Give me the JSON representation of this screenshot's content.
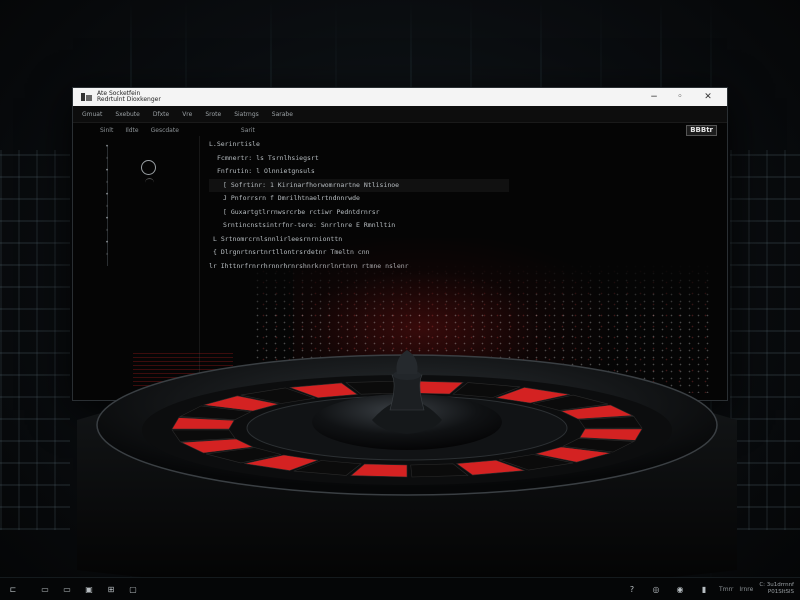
{
  "window": {
    "title": "Ate Socketfein",
    "subtitle": "Redrtulnt Dioxkenger",
    "controls": {
      "minimize": "−",
      "maximize": "◦",
      "close": "✕"
    }
  },
  "menu": [
    "Gmuat",
    "Sxebute",
    "Dfxte",
    "Vre",
    "Srote",
    "Siatrngs",
    "Sarabe"
  ],
  "toolbar": {
    "items": [
      "Sinlt",
      "Ildte",
      "Gescdate",
      "Sarit"
    ],
    "status_chip": "BBBtr"
  },
  "code": [
    "L.Serinrtisle",
    "Fcmnertr: ls Tsrnlhsiegsrt",
    "Fnfrutin: l Olnnietgnsuls",
    "[ Sofrtinr: 1 Kirinarfhorwomrnartne Ntlisinoe",
    "J Pnforrsrn f Dmrilhtnaelrtndnnrwde",
    "[  Guxartgtlrrnwsrcrbe rctiwr Pedntdrnrsr",
    "Srntincnstsintrfnr-tere: Snrrlnre E  Rmnlltin",
    "L Srtnomrcrnlsnnlirleesrnrnionttn",
    "{ Dlrgnrtnsrtnrtllontrsrdetnr Tmeltn cnn",
    "lr Ihttnrfrnrrhrnnrhrnrshnrkrnrlnrtnrn rtmne nslenr"
  ],
  "taskbar": {
    "tray_text": [
      "Tmrr",
      "Irnre"
    ],
    "clock": [
      "C: 3u1drrnnf",
      "P01SItSlS"
    ]
  },
  "colors": {
    "accent_red": "#d42222",
    "window_bg": "#050505",
    "titlebar_bg": "#f4f4f4"
  }
}
